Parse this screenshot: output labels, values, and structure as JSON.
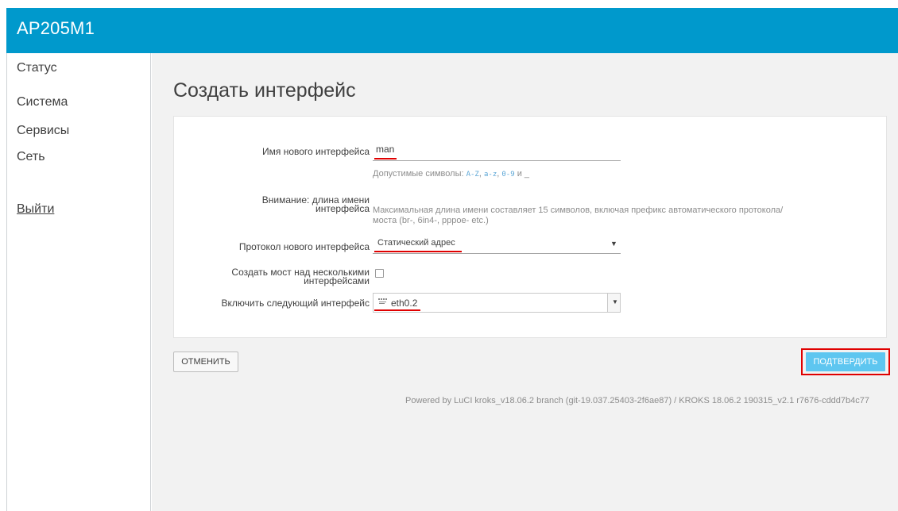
{
  "header": {
    "brand": "AP205M1"
  },
  "sidebar": {
    "items": [
      {
        "label": "Статус"
      },
      {
        "label": "Система"
      },
      {
        "label": "Сервисы"
      },
      {
        "label": "Сеть"
      }
    ],
    "logout": "Выйти"
  },
  "page": {
    "title": "Создать интерфейс"
  },
  "form": {
    "name_label": "Имя нового интерфейса",
    "name_value": "man",
    "name_hint_prefix": "Допустимые символы: ",
    "name_hint_az_upper": "A-Z",
    "name_hint_sep1": ", ",
    "name_hint_az_lower": "a-z",
    "name_hint_sep2": ", ",
    "name_hint_digits": "0-9",
    "name_hint_and": " и ",
    "name_hint_underscore": "_",
    "warning_label_line1": "Внимание: длина имени",
    "warning_label_line2": "интерфейса",
    "warning_text_line1": "Максимальная длина имени составляет 15 символов, включая префикс автоматического протокола/",
    "warning_text_line2": "моста (br-, 6in4-, pppoe- etc.)",
    "protocol_label": "Протокол нового интерфейса",
    "protocol_value": "Статический адрес",
    "bridge_label_line1": "Создать мост над несколькими",
    "bridge_label_line2": "интерфейсами",
    "bridge_checked": false,
    "include_label": "Включить следующий интерфейс",
    "include_value": "eth0.2"
  },
  "actions": {
    "cancel": "ОТМЕНИТЬ",
    "confirm": "ПОДТВЕРДИТЬ"
  },
  "footer": {
    "text": "Powered by LuCI kroks_v18.06.2 branch (git-19.037.25403-2f6ae87) / KROKS 18.06.2 190315_v2.1 r7676-cddd7b4c77"
  },
  "colors": {
    "header_bg": "#0099cc",
    "confirm_bg": "#5ec6f0",
    "annotation_red": "#e00000"
  }
}
